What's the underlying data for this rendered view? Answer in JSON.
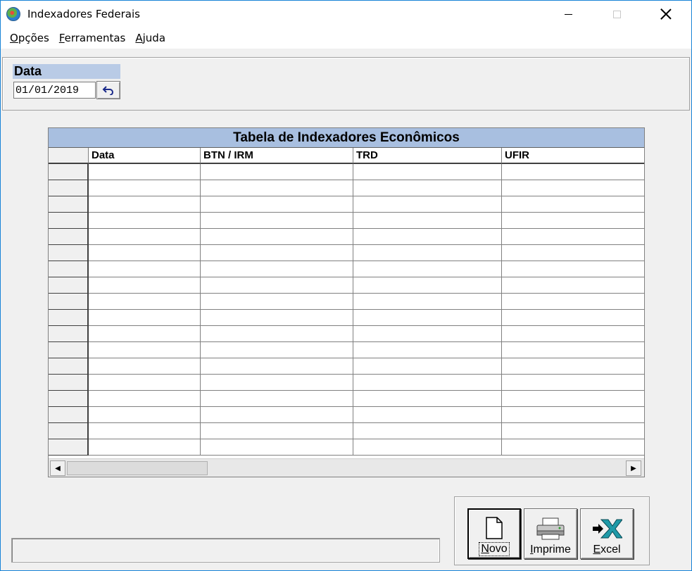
{
  "window": {
    "title": "Indexadores Federais"
  },
  "menu": {
    "items": [
      "Opções",
      "Ferramentas",
      "Ajuda"
    ]
  },
  "data_panel": {
    "label": "Data",
    "date_value": "01/01/2019"
  },
  "grid": {
    "caption": "Tabela de Indexadores Econômicos",
    "columns": [
      "",
      "Data",
      "BTN / IRM",
      "TRD",
      "UFIR"
    ],
    "row_count": 18
  },
  "buttons": {
    "novo": "Novo",
    "imprime": "Imprime",
    "excel": "Excel"
  },
  "status": {
    "text": ""
  },
  "colors": {
    "caption_bg": "#a8bfe0",
    "label_bg": "#b9cbe6",
    "window_border": "#1883d7"
  }
}
